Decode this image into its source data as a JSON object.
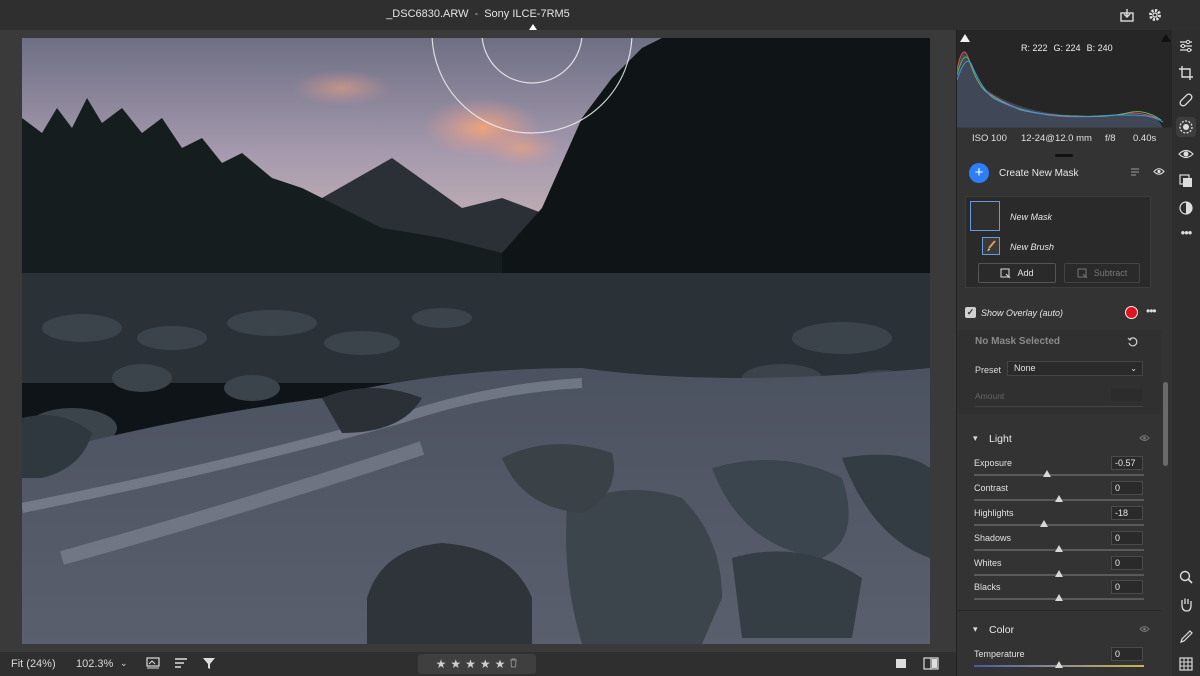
{
  "window": {
    "filename": "_DSC6830.ARW",
    "separator": "-",
    "camera": "Sony ILCE-7RM5"
  },
  "top_icons": [
    "export-icon",
    "gear-icon"
  ],
  "histogram": {
    "r_label": "R: 222",
    "g_label": "G: 224",
    "b_label": "B: 240"
  },
  "exif": {
    "iso": "ISO 100",
    "lens": "12-24@12.0 mm",
    "aperture": "f/8",
    "shutter": "0.40s"
  },
  "masking": {
    "create_label": "Create New Mask",
    "plus": "+",
    "mask_name": "New Mask",
    "brush_name": "New Brush",
    "add_label": "Add",
    "subtract_label": "Subtract",
    "overlay_label": "Show Overlay (auto)",
    "overlay_color": "#e0141e",
    "more": "•••"
  },
  "no_mask": {
    "title": "No Mask Selected",
    "preset_label": "Preset",
    "preset_value": "None",
    "amount_label": "Amount"
  },
  "light": {
    "title": "Light",
    "sliders": [
      {
        "label": "Exposure",
        "value": "-0.57",
        "position": 0.43
      },
      {
        "label": "Contrast",
        "value": "0",
        "position": 0.5
      },
      {
        "label": "Highlights",
        "value": "-18",
        "position": 0.41
      },
      {
        "label": "Shadows",
        "value": "0",
        "position": 0.5
      },
      {
        "label": "Whites",
        "value": "0",
        "position": 0.5
      },
      {
        "label": "Blacks",
        "value": "0",
        "position": 0.5
      }
    ]
  },
  "color": {
    "title": "Color",
    "sliders": [
      {
        "label": "Temperature",
        "value": "0",
        "position": 0.5
      }
    ]
  },
  "bottom": {
    "fit_label": "Fit (24%)",
    "zoom_label": "102.3%",
    "stars": [
      "★",
      "★",
      "★",
      "★",
      "★"
    ]
  },
  "tools": [
    "edit-icon",
    "crop-icon",
    "heal-icon",
    "mask-icon",
    "redeye-icon",
    "layers-icon",
    "presets-icon",
    "more-icon",
    "zoom-icon",
    "hand-icon",
    "sampler-icon",
    "grid-icon"
  ]
}
